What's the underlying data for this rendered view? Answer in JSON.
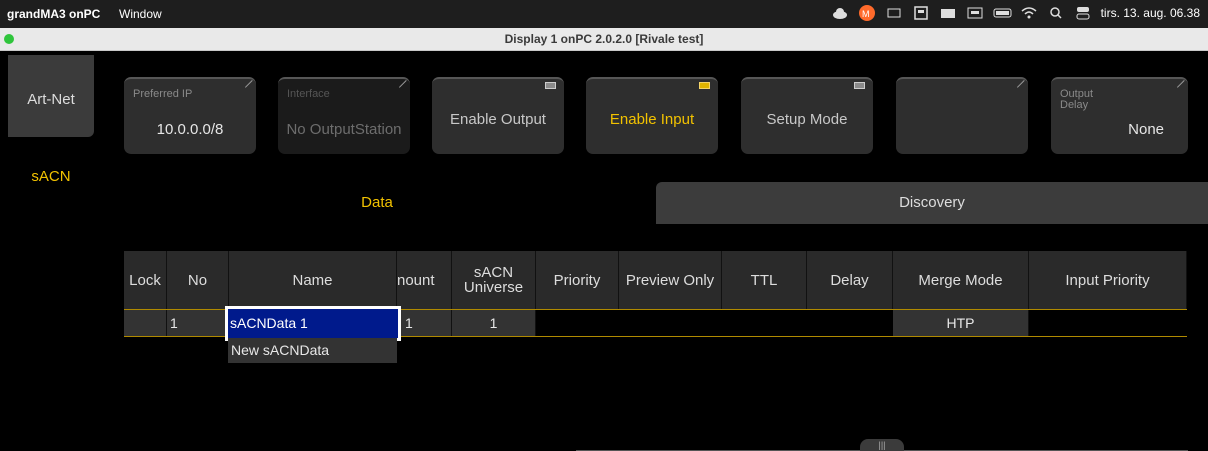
{
  "menubar": {
    "app_name": "grandMA3 onPC",
    "window_menu": "Window",
    "datetime": "tirs. 13. aug.  06.38",
    "icons": [
      "cloud-icon",
      "app-badge-icon",
      "screen-icon",
      "calculator-icon",
      "memory-icon",
      "keyboard-icon",
      "battery-icon",
      "wifi-icon",
      "search-icon",
      "control-center-icon"
    ]
  },
  "titlebar": {
    "title": "Display 1 onPC 2.0.2.0 [Rivale test]"
  },
  "left_tabs": {
    "artnet": "Art-Net",
    "sacn": "sACN"
  },
  "buttons": {
    "preferred_ip": {
      "label": "Preferred IP",
      "value": "10.0.0.0/8"
    },
    "interface": {
      "label": "Interface",
      "value": "No OutputStation"
    },
    "enable_output": "Enable Output",
    "enable_input": "Enable Input",
    "setup_mode": "Setup Mode",
    "output_delay": {
      "label": "Output Delay",
      "value": "None"
    }
  },
  "subtabs": {
    "data": "Data",
    "discovery": "Discovery"
  },
  "grid": {
    "headers": [
      "Lock",
      "No",
      "Name",
      "nount",
      "sACN Universe",
      "Priority",
      "Preview Only",
      "TTL",
      "Delay",
      "Merge Mode",
      "Input Priority"
    ],
    "row": {
      "no": "1",
      "name": "sACNData 1",
      "amount": "1",
      "universe": "1",
      "merge_mode": "HTP"
    },
    "new_item": "New sACNData"
  },
  "colors": {
    "accent": "#f2c200",
    "selection": "#001a8c"
  }
}
